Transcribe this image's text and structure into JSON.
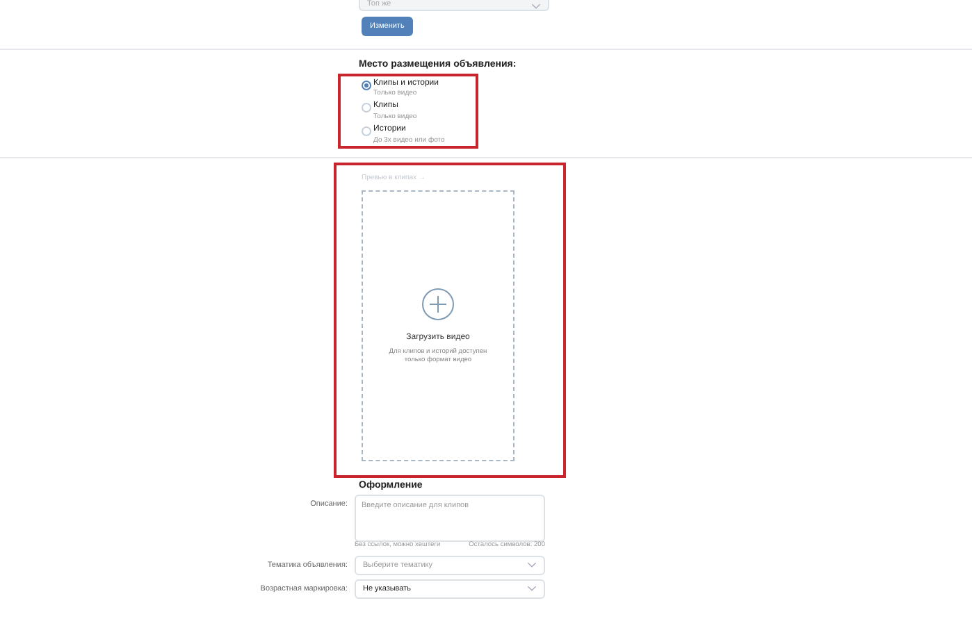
{
  "top_select": {
    "value": "Топ же"
  },
  "change_button": "Изменить",
  "placement": {
    "title": "Место размещения объявления:",
    "highlighted": true,
    "options": [
      {
        "label": "Клипы и истории",
        "hint": "Только видео",
        "selected": true
      },
      {
        "label": "Клипы",
        "hint": "Только видео",
        "selected": false
      },
      {
        "label": "Истории",
        "hint": "До 3х видео или фото",
        "selected": false
      }
    ]
  },
  "preview": {
    "highlighted": true,
    "label": "Превью в клипах →",
    "upload_title": "Загрузить видео",
    "upload_hint_lines": [
      "Для клипов и историй доступен",
      "только формат видео"
    ]
  },
  "design": {
    "title": "Оформление",
    "description": {
      "label": "Описание:",
      "placeholder": "Введите описание для клипов",
      "hint": "Без ссылок, можно хештеги",
      "counter": "Осталось символов: 200"
    },
    "fields": [
      {
        "label": "Тематика объявления:",
        "value": "Выберите тематику",
        "empty": true
      },
      {
        "label": "Возрастная маркировка:",
        "value": "Не указывать",
        "empty": false
      }
    ]
  }
}
